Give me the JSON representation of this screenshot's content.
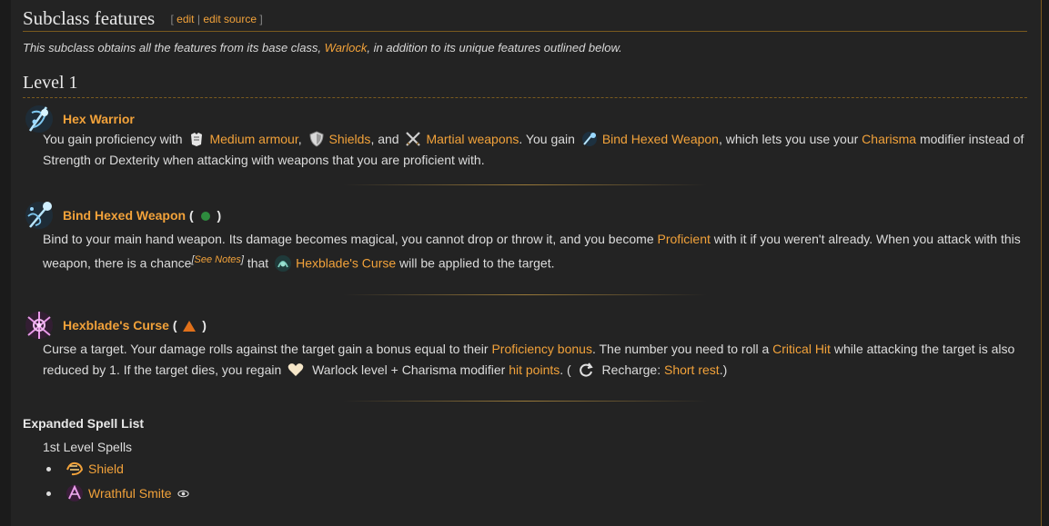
{
  "section": {
    "title": "Subclass features",
    "edit_open": "[",
    "edit": "edit",
    "sep": "|",
    "edit_source": "edit source",
    "edit_close": "]"
  },
  "intro": {
    "pre": "This subclass obtains all the features from its base class, ",
    "link": "Warlock",
    "post": ", in addition to its unique features outlined below."
  },
  "level": {
    "title": "Level 1"
  },
  "features": [
    {
      "title": "Hex Warrior",
      "icon": "hex-warrior-icon",
      "text": {
        "t1": "You gain proficiency with",
        "l1": "Medium armour",
        "t2": ",",
        "l2": "Shields",
        "t3": ", and",
        "l3": "Martial weapons",
        "t4": ". You gain",
        "l4": "Bind Hexed Weapon",
        "t5": ", which lets you use your",
        "l5": "Charisma",
        "t6": "modifier instead of Strength or Dexterity when attacking with weapons that you are proficient with."
      }
    },
    {
      "title": "Bind Hexed Weapon",
      "paren_open": "(",
      "paren_close": ")",
      "icon": "bind-hexed-weapon-icon",
      "text": {
        "t1": "Bind to your main hand weapon. Its damage becomes magical, you cannot drop or throw it, and you become",
        "l1": "Proficient",
        "t2": "with it if you weren't already. When you attack with this weapon, there is a chance",
        "note_open": "[",
        "note": "See Notes",
        "note_close": "]",
        "t3": "that",
        "l2": "Hexblade's Curse",
        "t4": "will be applied to the target."
      }
    },
    {
      "title": "Hexblade's Curse",
      "paren_open": "(",
      "paren_close": ")",
      "icon": "hexblades-curse-icon",
      "text": {
        "t1": "Curse a target. Your damage rolls against the target gain a bonus equal to their",
        "l1": "Proficiency bonus",
        "t2": ". The number you need to roll a",
        "l2": "Critical Hit",
        "t3": "while attacking the target is also reduced by 1. If the target dies, you regain",
        "t4": "Warlock level + Charisma modifier",
        "l3": "hit points",
        "t5": ". (",
        "t6": "Recharge:",
        "l4": "Short rest",
        "t7": ".)"
      }
    }
  ],
  "spells": {
    "title": "Expanded Spell List",
    "sub": "1st Level Spells",
    "items": [
      {
        "label": "Shield",
        "icon": "shield-spell-icon"
      },
      {
        "label": "Wrathful Smite",
        "icon": "wrathful-smite-icon"
      }
    ]
  },
  "colors": {
    "link": "#f2a23a",
    "background": "#232323",
    "action": "#2e8b3e",
    "bonus": "#e0701a"
  }
}
